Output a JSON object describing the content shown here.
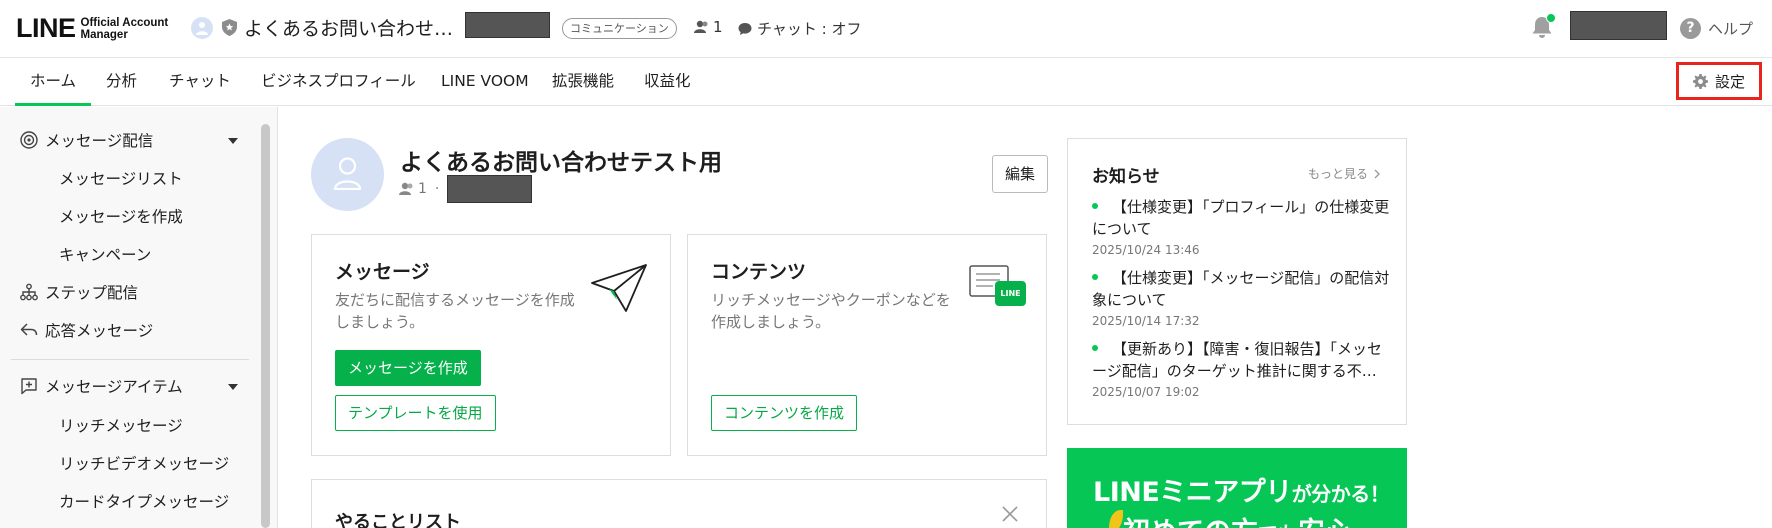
{
  "header": {
    "logo_main": "LINE",
    "logo_sub_line1": "Official Account",
    "logo_sub_line2": "Manager",
    "account_name": "よくあるお問い合わせ…",
    "category_badge": "コミュニケーション",
    "friend_count": "1",
    "chat_status": "チャット : オフ",
    "help_label": "ヘルプ",
    "help_glyph": "?"
  },
  "nav": {
    "tabs": [
      {
        "label": "ホーム",
        "active": true
      },
      {
        "label": "分析"
      },
      {
        "label": "チャット"
      },
      {
        "label": "ビジネスプロフィール"
      },
      {
        "label": "LINE VOOM"
      },
      {
        "label": "拡張機能"
      },
      {
        "label": "収益化"
      }
    ],
    "settings_label": "設定"
  },
  "sidebar": {
    "groups": [
      {
        "label": "メッセージ配信",
        "icon": "broadcast-icon",
        "children": [
          "メッセージリスト",
          "メッセージを作成",
          "キャンペーン"
        ]
      },
      {
        "label": "ステップ配信",
        "icon": "step-flow-icon"
      },
      {
        "label": "応答メッセージ",
        "icon": "reply-icon"
      },
      {
        "label": "メッセージアイテム",
        "icon": "add-message-icon",
        "children": [
          "リッチメッセージ",
          "リッチビデオメッセージ",
          "カードタイプメッセージ"
        ]
      }
    ]
  },
  "profile": {
    "name": "よくあるお問い合わせテスト用",
    "friend_count": "1",
    "separator": "·",
    "edit_label": "編集"
  },
  "cards": {
    "message": {
      "title": "メッセージ",
      "description": "友だちに配信するメッセージを作成しましょう。",
      "primary_button": "メッセージを作成",
      "secondary_button": "テンプレートを使用"
    },
    "contents": {
      "title": "コンテンツ",
      "description": "リッチメッセージやクーポンなどを作成しましょう。",
      "button": "コンテンツを作成",
      "icon_badge": "LINE"
    },
    "todo": {
      "title": "やることリスト"
    }
  },
  "news": {
    "title": "お知らせ",
    "more_label": "もっと見る",
    "items": [
      {
        "text": "【仕様変更】「プロフィール」の仕様変更について",
        "date": "2025/10/24 13:46"
      },
      {
        "text": "【仕様変更】「メッセージ配信」の配信対象について",
        "date": "2025/10/14 17:32"
      },
      {
        "text": "【更新あり】【障害・復旧報告】「メッセージ配信」のターゲット推計に関する不…",
        "date": "2025/10/07 19:02"
      }
    ]
  },
  "banner": {
    "line1_big": "LINEミニアプリ",
    "line1_small": "が分かる！",
    "line2_big": "初めての方",
    "line2_small": "でも",
    "line2_end": "安心"
  },
  "colors": {
    "accent_green": "#06c755",
    "button_green": "#06b14b",
    "highlight_red": "#e8251d"
  }
}
